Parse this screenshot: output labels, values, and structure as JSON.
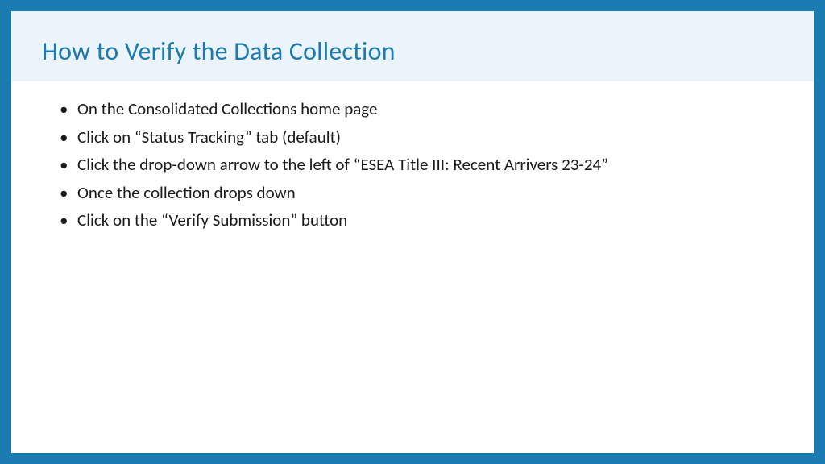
{
  "slide": {
    "title": "How to Verify the Data Collection",
    "bullets": [
      "On the Consolidated Collections home page",
      "Click on “Status Tracking” tab (default)",
      "Click the drop-down arrow to the left of “ESEA Title III: Recent Arrivers 23-24”",
      "Once the collection drops down",
      "Click on the “Verify Submission” button"
    ]
  }
}
